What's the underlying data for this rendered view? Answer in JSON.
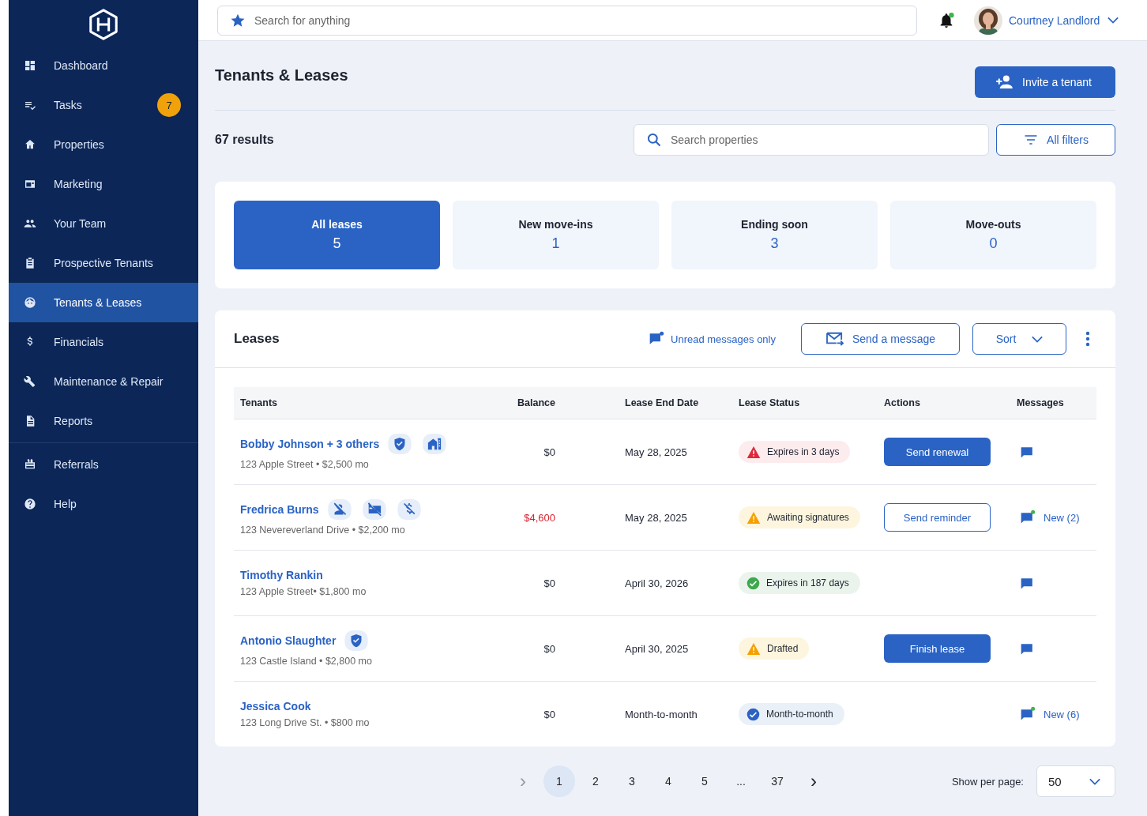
{
  "sidebar": {
    "items": [
      {
        "label": "Dashboard",
        "selected": false
      },
      {
        "label": "Tasks",
        "selected": false,
        "badge": "7"
      },
      {
        "label": "Properties",
        "selected": false
      },
      {
        "label": "Marketing",
        "selected": false
      },
      {
        "label": "Your Team",
        "selected": false
      },
      {
        "label": "Prospective Tenants",
        "selected": false
      },
      {
        "label": "Tenants & Leases",
        "selected": true
      },
      {
        "label": "Financials",
        "selected": false
      },
      {
        "label": "Maintenance & Repair",
        "selected": false
      },
      {
        "label": "Reports",
        "selected": false
      }
    ],
    "footer_items": [
      {
        "label": "Referrals",
        "selected": false
      },
      {
        "label": "Help",
        "selected": false
      }
    ]
  },
  "topbar": {
    "search": {
      "placeholder": "Search for anything"
    },
    "notifications": {
      "unread": true
    },
    "user": {
      "name": "Courtney Landlord"
    }
  },
  "page": {
    "title": "Tenants & Leases",
    "invite_button": "Invite a tenant",
    "results": "67 results",
    "search": {
      "placeholder": "Search properties"
    },
    "filters_button": "All filters"
  },
  "summary_tabs": [
    {
      "label": "All leases",
      "count": "5",
      "selected": true
    },
    {
      "label": "New move-ins",
      "count": "1",
      "selected": false
    },
    {
      "label": "Ending soon",
      "count": "3",
      "selected": false
    },
    {
      "label": "Move-outs",
      "count": "0",
      "selected": false
    }
  ],
  "leases": {
    "title": "Leases",
    "unread_toggle": "Unread messages only",
    "send_message": "Send a message",
    "sort": "Sort",
    "columns": [
      "Tenants",
      "Balance",
      "Lease End Date",
      "Lease Status",
      "Actions",
      "Messages"
    ],
    "rows": [
      {
        "name": "Bobby Johnson + 3 others",
        "address": "123 Apple Street • $2,500 mo",
        "badges": [
          {
            "kind": "shield"
          },
          {
            "kind": "house"
          }
        ],
        "balance": "$0",
        "overdue": false,
        "end_date": "May 28, 2025",
        "status": {
          "text": "Expires in 3 days",
          "kind": "danger"
        },
        "action": {
          "label": "Send renewal",
          "kind": "primary"
        },
        "messages": {
          "unread": false
        }
      },
      {
        "name": "Fredrica Burns",
        "address": "123 Nevereverland Drive • $2,200 mo",
        "badges": [
          {
            "kind": "no-person"
          },
          {
            "kind": "no-card"
          },
          {
            "kind": "no-dollar"
          }
        ],
        "balance": "$4,600",
        "overdue": true,
        "end_date": "May 28, 2025",
        "status": {
          "text": "Awaiting signatures",
          "kind": "warning"
        },
        "action": {
          "label": "Send reminder",
          "kind": "outline"
        },
        "messages": {
          "unread": true,
          "label": "New (2)"
        }
      },
      {
        "name": "Timothy Rankin",
        "address": "123 Apple Street• $1,800 mo",
        "badges": [],
        "balance": "$0",
        "overdue": false,
        "end_date": "April 30, 2026",
        "status": {
          "text": "Expires in 187 days",
          "kind": "success"
        },
        "messages": {
          "unread": false
        }
      },
      {
        "name": "Antonio Slaughter",
        "address": "123 Castle Island • $2,800 mo",
        "badges": [
          {
            "kind": "shield"
          }
        ],
        "balance": "$0",
        "overdue": false,
        "end_date": "April 30, 2025",
        "status": {
          "text": "Drafted",
          "kind": "warning"
        },
        "action": {
          "label": "Finish lease",
          "kind": "primary"
        },
        "messages": {
          "unread": false
        }
      },
      {
        "name": "Jessica Cook",
        "address": "123 Long Drive St. • $800 mo",
        "badges": [],
        "balance": "$0",
        "overdue": false,
        "end_date": "Month-to-month",
        "status": {
          "text": "Month-to-month",
          "kind": "info"
        },
        "messages": {
          "unread": true,
          "label": "New (6)"
        }
      }
    ]
  },
  "pagination": {
    "prev": "›",
    "pages": [
      {
        "label": "1",
        "selected": true
      },
      {
        "label": "2",
        "selected": false
      },
      {
        "label": "3",
        "selected": false
      },
      {
        "label": "4",
        "selected": false
      },
      {
        "label": "5",
        "selected": false
      },
      {
        "label": "...",
        "selected": false
      },
      {
        "label": "37",
        "selected": false
      }
    ],
    "next": "›",
    "per_page_label": "Show per page:",
    "per_page": "50"
  }
}
